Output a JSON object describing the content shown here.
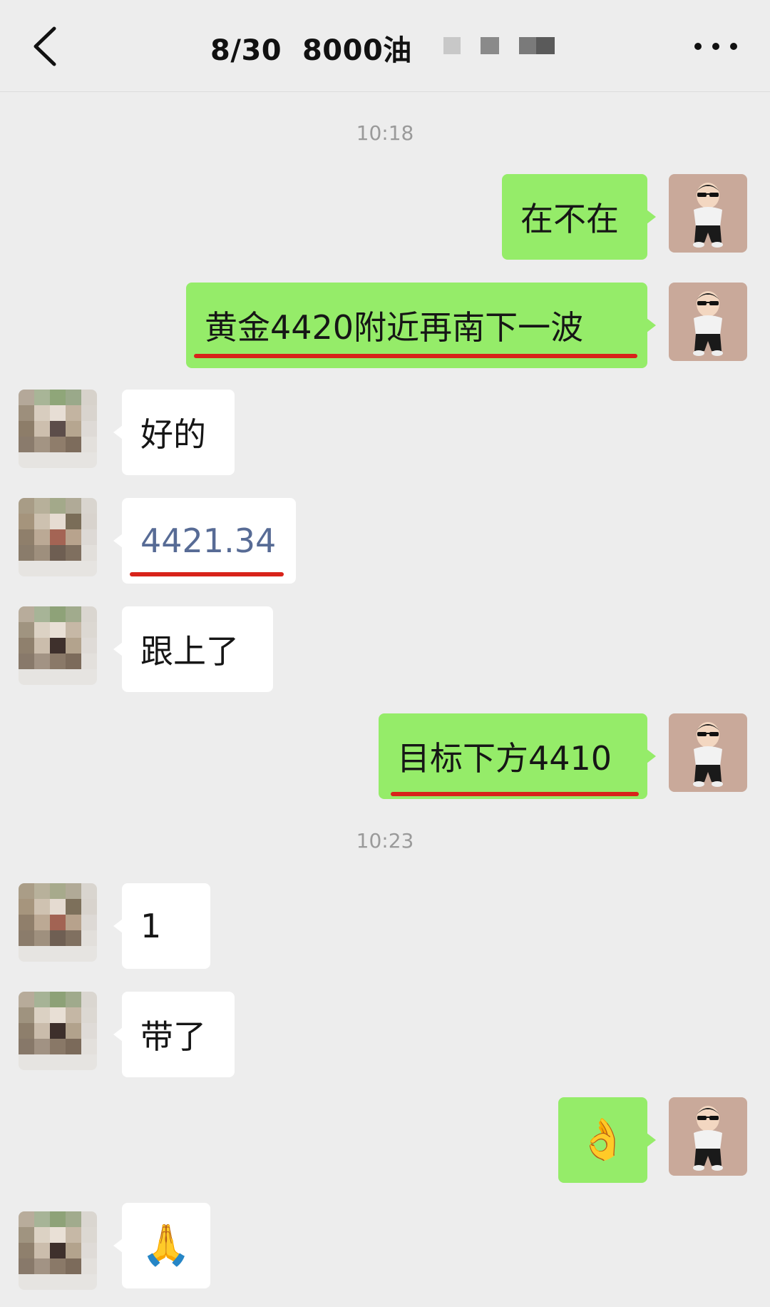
{
  "header": {
    "title": "8/30  8000油"
  },
  "timestamps": [
    "10:18",
    "10:23"
  ],
  "messages": [
    {
      "side": "me",
      "text": "在不在"
    },
    {
      "side": "me",
      "text": "黄金4420附近再南下一波"
    },
    {
      "side": "them",
      "text": "好的"
    },
    {
      "side": "them",
      "text": "4421.34"
    },
    {
      "side": "them",
      "text": "跟上了"
    },
    {
      "side": "me",
      "text": "目标下方4410"
    },
    {
      "side": "them",
      "text": "1"
    },
    {
      "side": "them",
      "text": "带了"
    },
    {
      "side": "me",
      "text": "👌"
    },
    {
      "side": "them",
      "text": "🙏"
    }
  ],
  "icons": {
    "back": "back-chevron-icon",
    "more": "more-dots-icon"
  },
  "colors": {
    "background": "#ededed",
    "my_bubble": "#95ec69",
    "their_bubble": "#ffffff",
    "link_text": "#576b95",
    "underline": "#d8231a"
  }
}
